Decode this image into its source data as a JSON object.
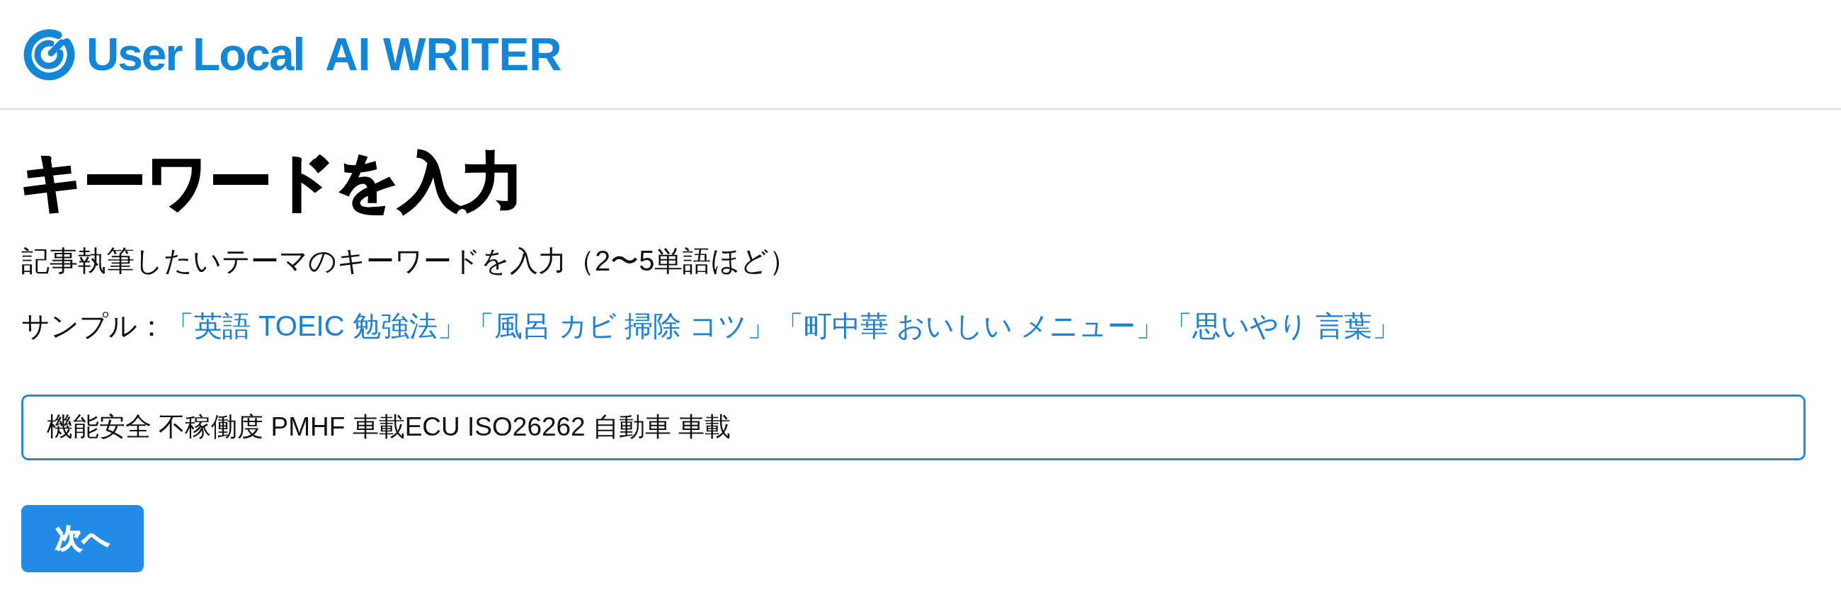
{
  "header": {
    "brand": "User Local",
    "product": "AI WRITER"
  },
  "heading": "キーワードを入力",
  "description": "記事執筆したいテーマのキーワードを入力（2〜5単語ほど）",
  "samples": {
    "label": "サンプル：",
    "links": [
      "「英語 TOEIC 勉強法」",
      "「風呂 カビ 掃除 コツ」",
      "「町中華 おいしい メニュー」",
      "「思いやり 言葉」"
    ]
  },
  "keyword_field": {
    "value": "機能安全 不稼働度 PMHF 車載ECU ISO26262 自動車 車載",
    "focused": true
  },
  "next_button": {
    "label": "次へ"
  }
}
